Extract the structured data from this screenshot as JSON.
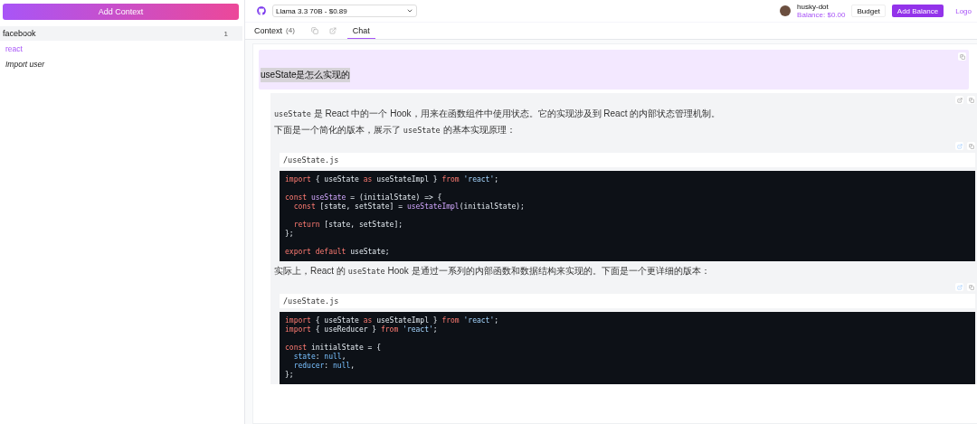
{
  "sidebar": {
    "add_button": "Add Context",
    "groups": [
      {
        "name": "facebook",
        "count": "1",
        "expanded": true,
        "children": [
          {
            "kind": "link",
            "label": "react"
          },
          {
            "kind": "action",
            "label": "Import user"
          }
        ]
      }
    ]
  },
  "header": {
    "model_select": {
      "value": "Llama 3.3 70B - $0.89"
    },
    "user": {
      "name": "husky-dot",
      "balance": "Balance: $0.00"
    },
    "buttons": [
      {
        "kind": "outline",
        "label": "Budget"
      },
      {
        "kind": "primary",
        "label": "Add Balance"
      },
      {
        "kind": "link",
        "label": "Logo"
      }
    ]
  },
  "tabs": [
    {
      "kind": "tab",
      "label": "Context",
      "count": "(4)",
      "selected": false
    },
    {
      "kind": "copy"
    },
    {
      "kind": "external"
    },
    {
      "kind": "tab",
      "label": "Chat",
      "selected": true
    }
  ],
  "messages": [
    {
      "kind": "user",
      "text": "useState是怎么实现的"
    },
    {
      "kind": "assistant",
      "blocks": [
        {
          "kind": "paragraph",
          "parts": [
            {
              "t": "useState",
              "code": true
            },
            {
              "t": " 是 React 中的一个 Hook，用来在函数组件中使用状态。它的实现涉及到 React 的内部状态管理机制。",
              "code": false
            }
          ]
        },
        {
          "kind": "paragraph",
          "parts": [
            {
              "t": "下面是一个简化的版本，展示了 ",
              "code": false
            },
            {
              "t": "useState",
              "code": true
            },
            {
              "t": " 的基本实现原理：",
              "code": false
            }
          ]
        },
        {
          "kind": "code",
          "filename": "/useState.js",
          "lines": [
            {
              "gap": false,
              "tokens": [
                {
                  "kind": "kw",
                  "t": "import"
                },
                {
                  "kind": "pl",
                  "t": " { useState "
                },
                {
                  "kind": "kw",
                  "t": "as"
                },
                {
                  "kind": "pl",
                  "t": " useStateImpl } "
                },
                {
                  "kind": "kw",
                  "t": "from "
                },
                {
                  "kind": "str",
                  "t": "'react'"
                },
                {
                  "kind": "pl",
                  "t": ";"
                }
              ]
            },
            {
              "gap": true,
              "tokens": [
                {
                  "kind": "kw",
                  "t": "const "
                },
                {
                  "kind": "fn",
                  "t": "useState"
                },
                {
                  "kind": "pl",
                  "t": " = (initialState) => {"
                }
              ]
            },
            {
              "gap": false,
              "tokens": [
                {
                  "kind": "kw",
                  "t": "  const"
                },
                {
                  "kind": "pl",
                  "t": " [state, setState] = "
                },
                {
                  "kind": "fn",
                  "t": "useStateImpl"
                },
                {
                  "kind": "pl",
                  "t": "(initialState);"
                }
              ]
            },
            {
              "gap": true,
              "tokens": [
                {
                  "kind": "kw",
                  "t": "  return"
                },
                {
                  "kind": "pl",
                  "t": " [state, setState];"
                }
              ]
            },
            {
              "gap": false,
              "tokens": [
                {
                  "kind": "pl",
                  "t": "};"
                }
              ]
            },
            {
              "gap": true,
              "tokens": [
                {
                  "kind": "kw",
                  "t": "export default"
                },
                {
                  "kind": "pl",
                  "t": " useState;"
                }
              ]
            }
          ]
        },
        {
          "kind": "paragraph",
          "parts": [
            {
              "t": "实际上，React 的 ",
              "code": false
            },
            {
              "t": "useState",
              "code": true
            },
            {
              "t": " Hook 是通过一系列的内部函数和数据结构来实现的。下面是一个更详细的版本：",
              "code": false
            }
          ]
        },
        {
          "kind": "code",
          "filename": "/useState.js",
          "lines": [
            {
              "gap": false,
              "tokens": [
                {
                  "kind": "kw",
                  "t": "import"
                },
                {
                  "kind": "pl",
                  "t": " { useState "
                },
                {
                  "kind": "kw",
                  "t": "as"
                },
                {
                  "kind": "pl",
                  "t": " useStateImpl } "
                },
                {
                  "kind": "kw",
                  "t": "from "
                },
                {
                  "kind": "str",
                  "t": "'react'"
                },
                {
                  "kind": "pl",
                  "t": ";"
                }
              ]
            },
            {
              "gap": false,
              "tokens": [
                {
                  "kind": "kw",
                  "t": "import"
                },
                {
                  "kind": "pl",
                  "t": " { useReducer } "
                },
                {
                  "kind": "kw",
                  "t": "from "
                },
                {
                  "kind": "str",
                  "t": "'react'"
                },
                {
                  "kind": "pl",
                  "t": ";"
                }
              ]
            },
            {
              "gap": true,
              "tokens": [
                {
                  "kind": "kw",
                  "t": "const"
                },
                {
                  "kind": "pl",
                  "t": " initialState = {"
                }
              ]
            },
            {
              "gap": false,
              "tokens": [
                {
                  "kind": "prop",
                  "t": "  state"
                },
                {
                  "kind": "pl",
                  "t": ": "
                },
                {
                  "kind": "prop",
                  "t": "null"
                },
                {
                  "kind": "pl",
                  "t": ","
                }
              ]
            },
            {
              "gap": false,
              "tokens": [
                {
                  "kind": "prop",
                  "t": "  reducer"
                },
                {
                  "kind": "pl",
                  "t": ": "
                },
                {
                  "kind": "prop",
                  "t": "null"
                },
                {
                  "kind": "pl",
                  "t": ","
                }
              ]
            },
            {
              "gap": false,
              "tokens": [
                {
                  "kind": "pl",
                  "t": "};"
                }
              ]
            }
          ]
        }
      ]
    }
  ]
}
